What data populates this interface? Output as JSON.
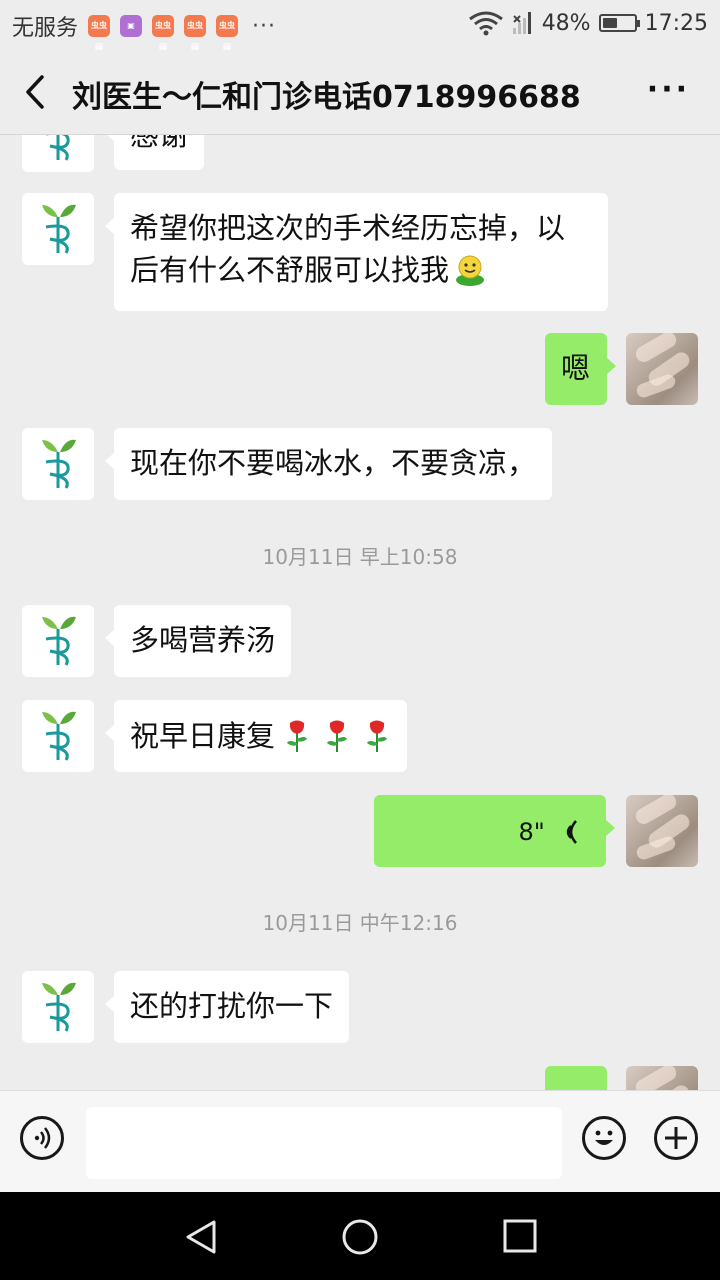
{
  "status_bar": {
    "carrier": "无服务",
    "app_badge": "虫虫网",
    "more_dots": "···",
    "battery_percent": "48%",
    "battery_level": 0.48,
    "time": "17:25"
  },
  "header": {
    "title": "刘医生～仁和门诊电话0718996688",
    "back_icon": "chevron-left-icon",
    "more_icon": "more-horizontal-icon"
  },
  "messages": [
    {
      "from": "doctor",
      "text": "感谢"
    },
    {
      "from": "doctor",
      "line1": "希望你把这次的手术经历忘掉，以",
      "line2": "后有什么不舒服可以找我",
      "emoji": "smile-face"
    },
    {
      "from": "me",
      "text": "嗯"
    },
    {
      "from": "doctor",
      "text": "现在你不要喝冰水，不要贪凉，"
    },
    {
      "type": "time",
      "text": "10月11日 早上10:58"
    },
    {
      "from": "doctor",
      "text": "多喝营养汤"
    },
    {
      "from": "doctor",
      "text": "祝早日康复",
      "emoji": "rose-icon"
    },
    {
      "from": "me",
      "type": "voice",
      "duration": "8\""
    },
    {
      "type": "time",
      "text": "10月11日 中午12:16"
    },
    {
      "from": "doctor",
      "text": "还的打扰你一下"
    }
  ],
  "input_bar": {
    "voice_icon": "voice-toggle-icon",
    "emoji_icon": "emoji-icon",
    "plus_icon": "plus-icon",
    "input_value": ""
  },
  "nav_bar": {
    "back_icon": "triangle-back-icon",
    "home_icon": "circle-home-icon",
    "recents_icon": "square-recents-icon"
  },
  "colors": {
    "sent_bubble": "#95ec69",
    "received_bubble": "#ffffff",
    "background": "#ededed"
  }
}
